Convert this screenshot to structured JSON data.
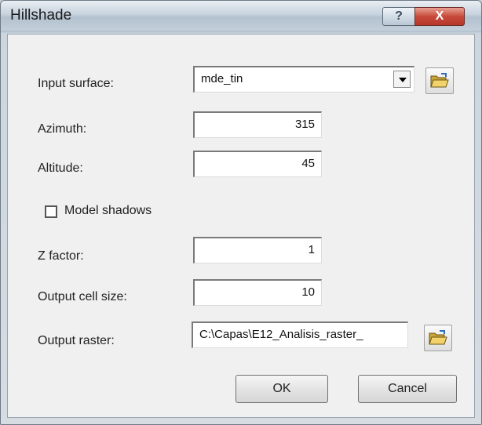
{
  "window": {
    "title": "Hillshade",
    "help_label": "?",
    "close_label": "X"
  },
  "form": {
    "input_surface_label": "Input surface:",
    "input_surface_value": "mde_tin",
    "azimuth_label": "Azimuth:",
    "azimuth_value": "315",
    "altitude_label": "Altitude:",
    "altitude_value": "45",
    "model_shadows_label": "Model shadows",
    "model_shadows_checked": false,
    "z_factor_label": "Z factor:",
    "z_factor_value": "1",
    "cell_size_label": "Output cell size:",
    "cell_size_value": "10",
    "output_raster_label": "Output raster:",
    "output_raster_value": "C:\\Capas\\E12_Analisis_raster_"
  },
  "buttons": {
    "ok_label": "OK",
    "cancel_label": "Cancel"
  },
  "icons": {
    "surface_browse": "open-folder-icon",
    "raster_browse": "open-folder-icon"
  }
}
